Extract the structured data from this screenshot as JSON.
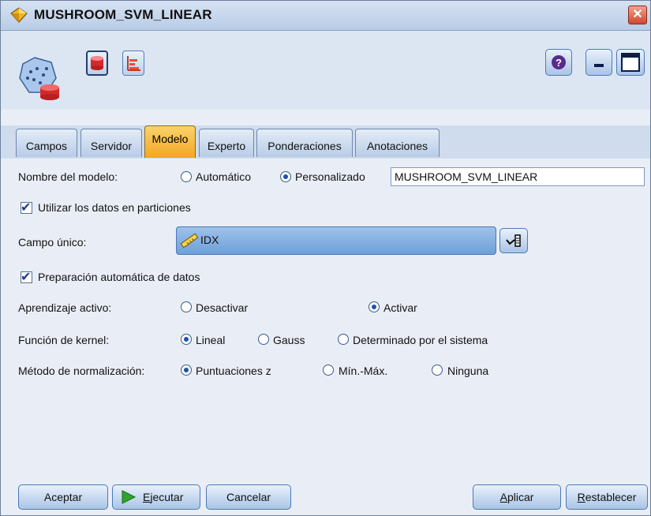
{
  "window": {
    "title": "MUSHROOM_SVM_LINEAR",
    "close_glyph": "✕"
  },
  "toolbar": {
    "icons": [
      "model-node-icon",
      "database-icon",
      "chart-icon",
      "help-icon",
      "minimize-icon",
      "maximize-icon"
    ],
    "help_glyph": "?"
  },
  "tabs": [
    {
      "label": "Campos"
    },
    {
      "label": "Servidor"
    },
    {
      "label": "Modelo"
    },
    {
      "label": "Experto"
    },
    {
      "label": "Ponderaciones"
    },
    {
      "label": "Anotaciones"
    }
  ],
  "active_tab": "Modelo",
  "form": {
    "model_name": {
      "label": "Nombre del modelo:",
      "opt_auto": "Automático",
      "opt_custom": "Personalizado",
      "selected": "Personalizado",
      "value": "MUSHROOM_SVM_LINEAR"
    },
    "use_partitions": {
      "label": "Utilizar los datos en particiones",
      "checked": true
    },
    "unique_field": {
      "label": "Campo único:",
      "value": "IDX"
    },
    "auto_prep": {
      "label": "Preparación automática de datos",
      "checked": true
    },
    "active_learning": {
      "label": "Aprendizaje activo:",
      "opt_off": "Desactivar",
      "opt_on": "Activar",
      "selected": "Activar"
    },
    "kernel": {
      "label": "Función de kernel:",
      "opt_linear": "Lineal",
      "opt_gauss": "Gauss",
      "opt_system": "Determinado por el sistema",
      "selected": "Lineal"
    },
    "normalization": {
      "label": "Método de normalización:",
      "opt_z": "Puntuaciones z",
      "opt_minmax": "Mín.-Máx.",
      "opt_none": "Ninguna",
      "selected": "Puntuaciones z"
    }
  },
  "footer": {
    "ok": "Aceptar",
    "run": "Ejecutar",
    "cancel": "Cancelar",
    "apply": "Aplicar",
    "reset": "Restablecer"
  },
  "colors": {
    "active_tab": "#f3a623",
    "field_bg": "#6ea0da",
    "run_arrow": "#2fa52f"
  }
}
